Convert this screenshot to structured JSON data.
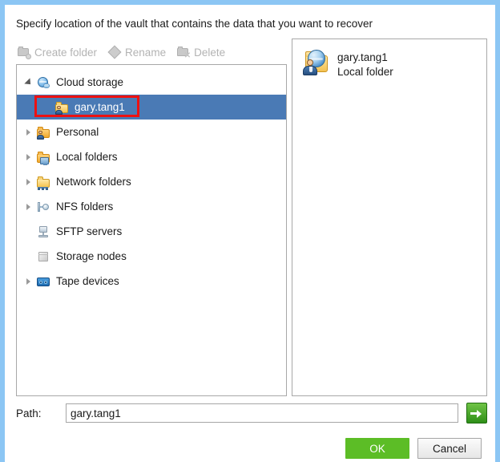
{
  "dialog": {
    "prompt": "Specify location of the vault that contains the data that you want to recover",
    "accent_border_color": "#8cc6f4"
  },
  "toolbar": {
    "buttons": [
      {
        "label": "Create folder",
        "icon": "new-folder-icon",
        "enabled": false
      },
      {
        "label": "Rename",
        "icon": "rename-icon",
        "enabled": false
      },
      {
        "label": "Delete",
        "icon": "delete-icon",
        "enabled": false
      }
    ]
  },
  "tree": {
    "nodes": [
      {
        "label": "Cloud storage",
        "icon": "cloud-storage-icon",
        "expander": "expanded",
        "indent": 0,
        "selected": false
      },
      {
        "label": "gary.tang1",
        "icon": "cloud-user-folder-icon",
        "expander": "none",
        "indent": 1,
        "selected": true
      },
      {
        "label": "Personal",
        "icon": "personal-folder-icon",
        "expander": "collapsed",
        "indent": 0,
        "selected": false
      },
      {
        "label": "Local folders",
        "icon": "local-folder-icon",
        "expander": "collapsed",
        "indent": 0,
        "selected": false
      },
      {
        "label": "Network folders",
        "icon": "network-folder-icon",
        "expander": "collapsed",
        "indent": 0,
        "selected": false
      },
      {
        "label": "NFS folders",
        "icon": "nfs-folder-icon",
        "expander": "collapsed",
        "indent": 0,
        "selected": false
      },
      {
        "label": "SFTP servers",
        "icon": "sftp-server-icon",
        "expander": "none",
        "indent": 0,
        "selected": false
      },
      {
        "label": "Storage nodes",
        "icon": "storage-node-icon",
        "expander": "none",
        "indent": 0,
        "selected": false
      },
      {
        "label": "Tape devices",
        "icon": "tape-device-icon",
        "expander": "collapsed",
        "indent": 0,
        "selected": false
      }
    ],
    "selection_color": "#4a7ab5",
    "annotation_color": "#ee1111"
  },
  "detail": {
    "icon": "cloud-user-folder-icon",
    "name": "gary.tang1",
    "type": "Local folder"
  },
  "path": {
    "label": "Path:",
    "value": "gary.tang1",
    "placeholder": "",
    "go_icon": "go-arrow-icon"
  },
  "footer": {
    "ok_label": "OK",
    "cancel_label": "Cancel",
    "ok_color": "#5cbd26"
  }
}
